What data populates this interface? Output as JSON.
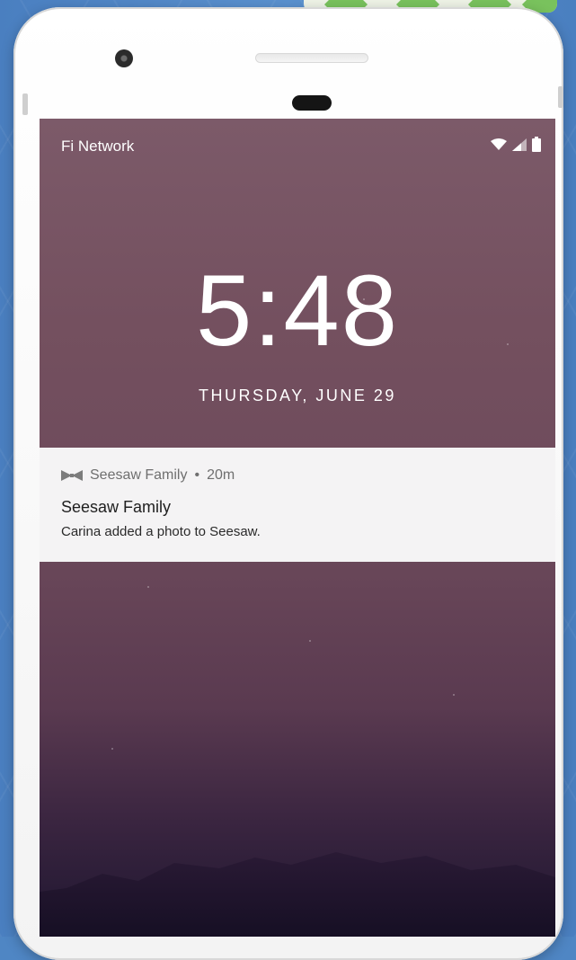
{
  "status_bar": {
    "carrier": "Fi Network",
    "icons": [
      "wifi-icon",
      "signal-icon",
      "battery-icon"
    ]
  },
  "lock_screen": {
    "time": "5:48",
    "date": "THURSDAY, JUNE 29"
  },
  "notification": {
    "app_icon": "seesaw-bowtie-icon",
    "app_name": "Seesaw Family",
    "separator": "•",
    "age": "20m",
    "title": "Seesaw Family",
    "text": "Carina added a photo to Seesaw."
  },
  "colors": {
    "background": "#4f86c4",
    "wallpaper_top": "#7c5a69",
    "wallpaper_bottom": "#1f1630",
    "notification_bg": "#f4f3f4"
  }
}
